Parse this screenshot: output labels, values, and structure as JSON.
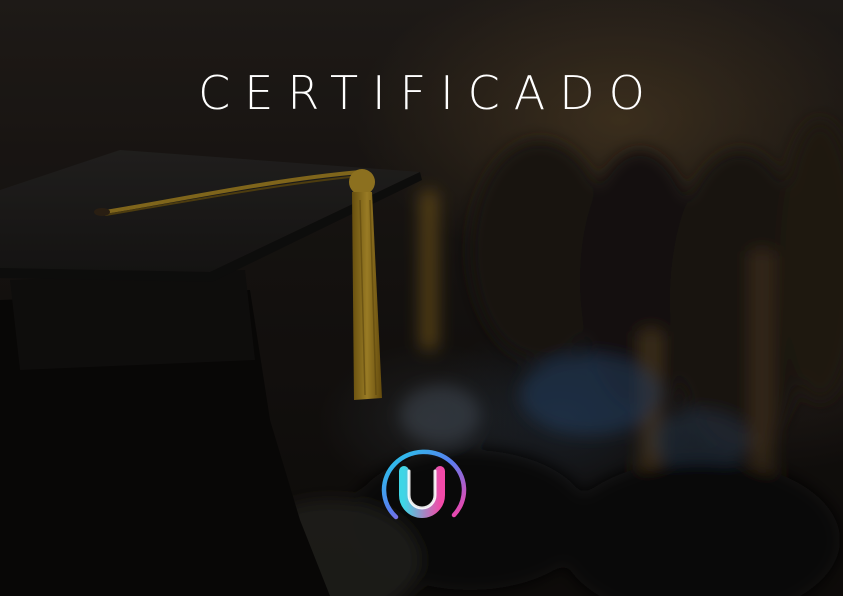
{
  "certificate": {
    "title": "CERTIFICADO"
  },
  "logo": {
    "icon": "u-ring-logo-icon",
    "gradient_colors": [
      "#1fd1e8",
      "#5b7cf0",
      "#ff3fa4"
    ]
  },
  "colors": {
    "title_text": "#ffffff",
    "background": "#1a1613",
    "tassel": "#c9a12a"
  }
}
